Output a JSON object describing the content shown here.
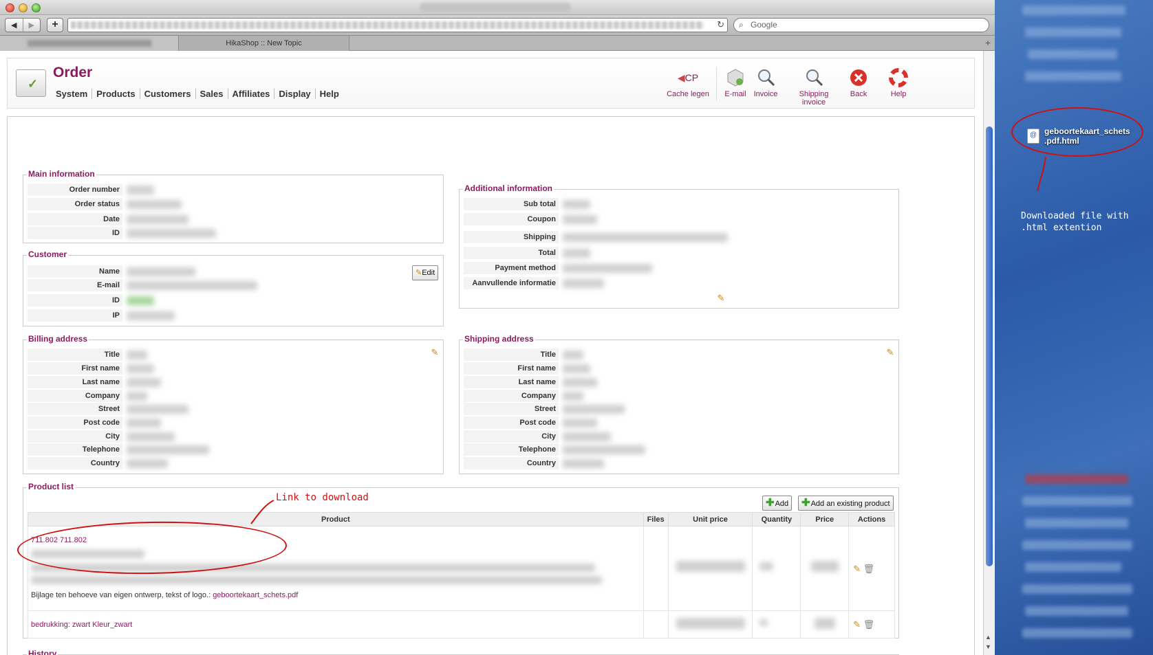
{
  "browser": {
    "tab_title": "HikaShop :: New Topic",
    "search_placeholder": "Google",
    "back_glyph": "◀",
    "forward_glyph": "▶",
    "new_tab_glyph": "+",
    "reload_glyph": "↻",
    "search_glyph": "⌕"
  },
  "header": {
    "title": "Order",
    "menu": [
      "System",
      "Products",
      "Customers",
      "Sales",
      "Affiliates",
      "Display",
      "Help"
    ],
    "toolbar": {
      "cache": "Cache legen",
      "cache_icon_text": "CP",
      "email": "E-mail",
      "invoice": "Invoice",
      "shipping_invoice": "Shipping invoice",
      "back": "Back",
      "help": "Help"
    }
  },
  "main_information": {
    "legend": "Main information",
    "labels": [
      "Order number",
      "Order status",
      "Date",
      "ID"
    ]
  },
  "customer": {
    "legend": "Customer",
    "labels": [
      "Name",
      "E-mail",
      "ID",
      "IP"
    ],
    "edit_label": "Edit"
  },
  "additional_information": {
    "legend": "Additional information",
    "labels": [
      "Sub total",
      "Coupon",
      "Shipping",
      "Total",
      "Payment method",
      "Aanvullende informatie"
    ]
  },
  "billing_address": {
    "legend": "Billing address",
    "labels": [
      "Title",
      "First name",
      "Last name",
      "Company",
      "Street",
      "Post code",
      "City",
      "Telephone",
      "Country"
    ]
  },
  "shipping_address": {
    "legend": "Shipping address",
    "labels": [
      "Title",
      "First name",
      "Last name",
      "Company",
      "Street",
      "Post code",
      "City",
      "Telephone",
      "Country"
    ]
  },
  "product_list": {
    "legend": "Product list",
    "add_label": "Add",
    "add_existing_label": "Add an existing product",
    "columns": [
      "Product",
      "Files",
      "Unit price",
      "Quantity",
      "Price",
      "Actions"
    ],
    "rows": [
      {
        "product_code": "711.802 711.802",
        "attachment_text": "Bijlage ten behoeve van eigen ontwerp, tekst of logo.:",
        "attachment_link": "geboortekaart_schets.pdf"
      },
      {
        "product_code": "bedrukking: zwart Kleur_zwart"
      }
    ]
  },
  "history": {
    "legend": "History"
  },
  "annotations": {
    "link_to_download": "Link to download",
    "downloaded_note_line1": "Downloaded file with",
    "downloaded_note_line2": ".html extention",
    "color": "#d01010"
  },
  "desktop": {
    "file_name_line1": "geboortekaart_schets",
    "file_name_line2": ".pdf.html"
  },
  "colors": {
    "accent": "#8b1a5e",
    "desktop_blue": "#2a5aa8"
  }
}
